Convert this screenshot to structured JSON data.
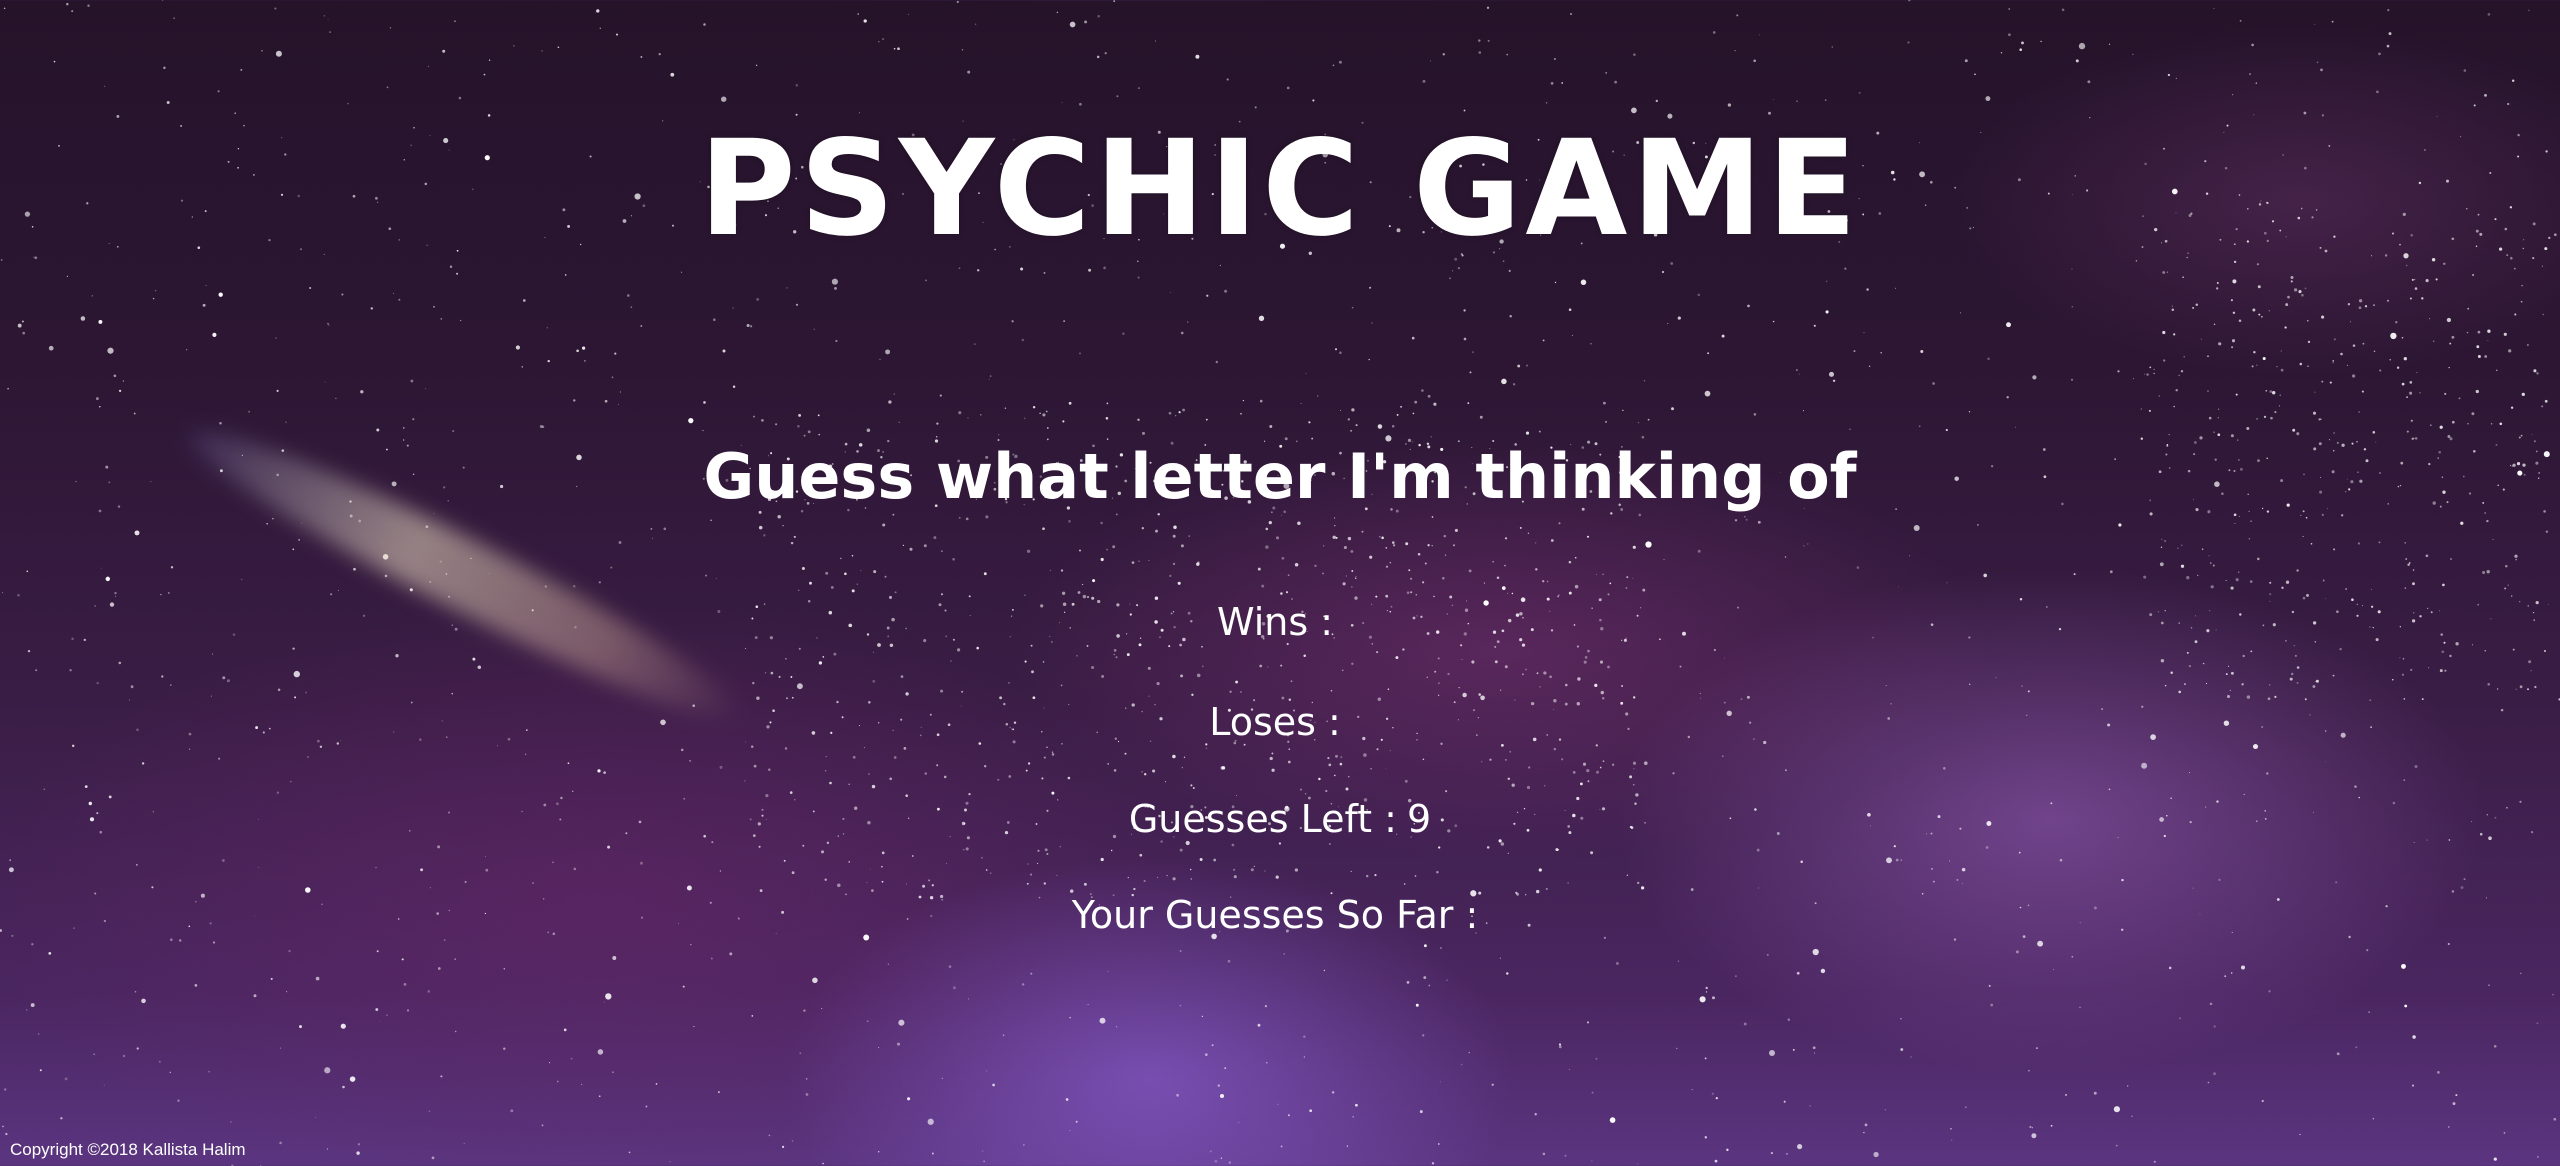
{
  "game": {
    "title": "PSYCHIC GAME",
    "subtitle": "Guess what letter I'm thinking of"
  },
  "stats": {
    "wins_label": "Wins :",
    "wins_value": "",
    "loses_label": "Loses :",
    "loses_value": "",
    "guesses_left_label": "Guesses Left :",
    "guesses_left_value": "9",
    "guesses_so_far_label": "Your Guesses So Far :",
    "guesses_so_far_value": ""
  },
  "footer": {
    "copyright": "Copyright ©2018 Kallista Halim"
  },
  "colors": {
    "text": "#ffffff",
    "background_top": "#25132a",
    "background_bottom": "#5b3580"
  }
}
